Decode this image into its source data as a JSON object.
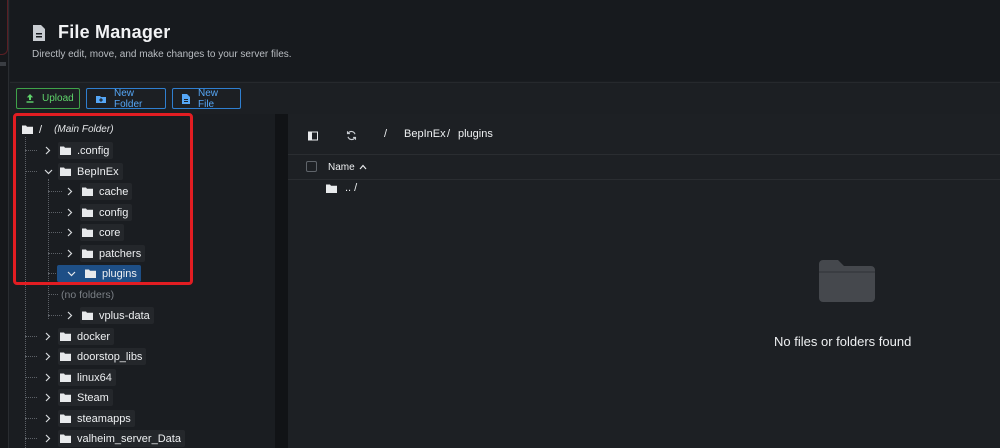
{
  "header": {
    "title": "File Manager",
    "subtitle": "Directly edit, move, and make changes to your server files.",
    "icon": "document-icon"
  },
  "toolbar": {
    "upload_label": "Upload",
    "new_folder_label": "New Folder",
    "new_file_label": "New File"
  },
  "tree": {
    "root_label": "/",
    "root_note": "(Main Folder)",
    "nodes": [
      {
        "label": ".config",
        "level": 1,
        "expanded": false
      },
      {
        "label": "BepInEx",
        "level": 1,
        "expanded": true
      },
      {
        "label": "cache",
        "level": 2,
        "expanded": false
      },
      {
        "label": "config",
        "level": 2,
        "expanded": false
      },
      {
        "label": "core",
        "level": 2,
        "expanded": false
      },
      {
        "label": "patchers",
        "level": 2,
        "expanded": false
      },
      {
        "label": "plugins",
        "level": 2,
        "expanded": true,
        "selected": true
      },
      {
        "label": "vplus-data",
        "level": 2,
        "expanded": false
      },
      {
        "label": "docker",
        "level": 1,
        "expanded": false
      },
      {
        "label": "doorstop_libs",
        "level": 1,
        "expanded": false
      },
      {
        "label": "linux64",
        "level": 1,
        "expanded": false
      },
      {
        "label": "Steam",
        "level": 1,
        "expanded": false
      },
      {
        "label": "steamapps",
        "level": 1,
        "expanded": false
      },
      {
        "label": "valheim_server_Data",
        "level": 1,
        "expanded": false
      }
    ],
    "empty_label": "(no folders)"
  },
  "browser": {
    "breadcrumb_root": "/",
    "breadcrumb": [
      "BepInEx",
      "plugins"
    ],
    "breadcrumb_sep": "/",
    "column_name": "Name",
    "sort_indicator": "^",
    "parent_row": ".. /",
    "empty_message": "No files or folders found"
  },
  "colors": {
    "accent_green": "#5fd46b",
    "accent_blue": "#55a6f5",
    "selected_bg": "#1e4f86",
    "highlight_red": "#e21d22"
  }
}
